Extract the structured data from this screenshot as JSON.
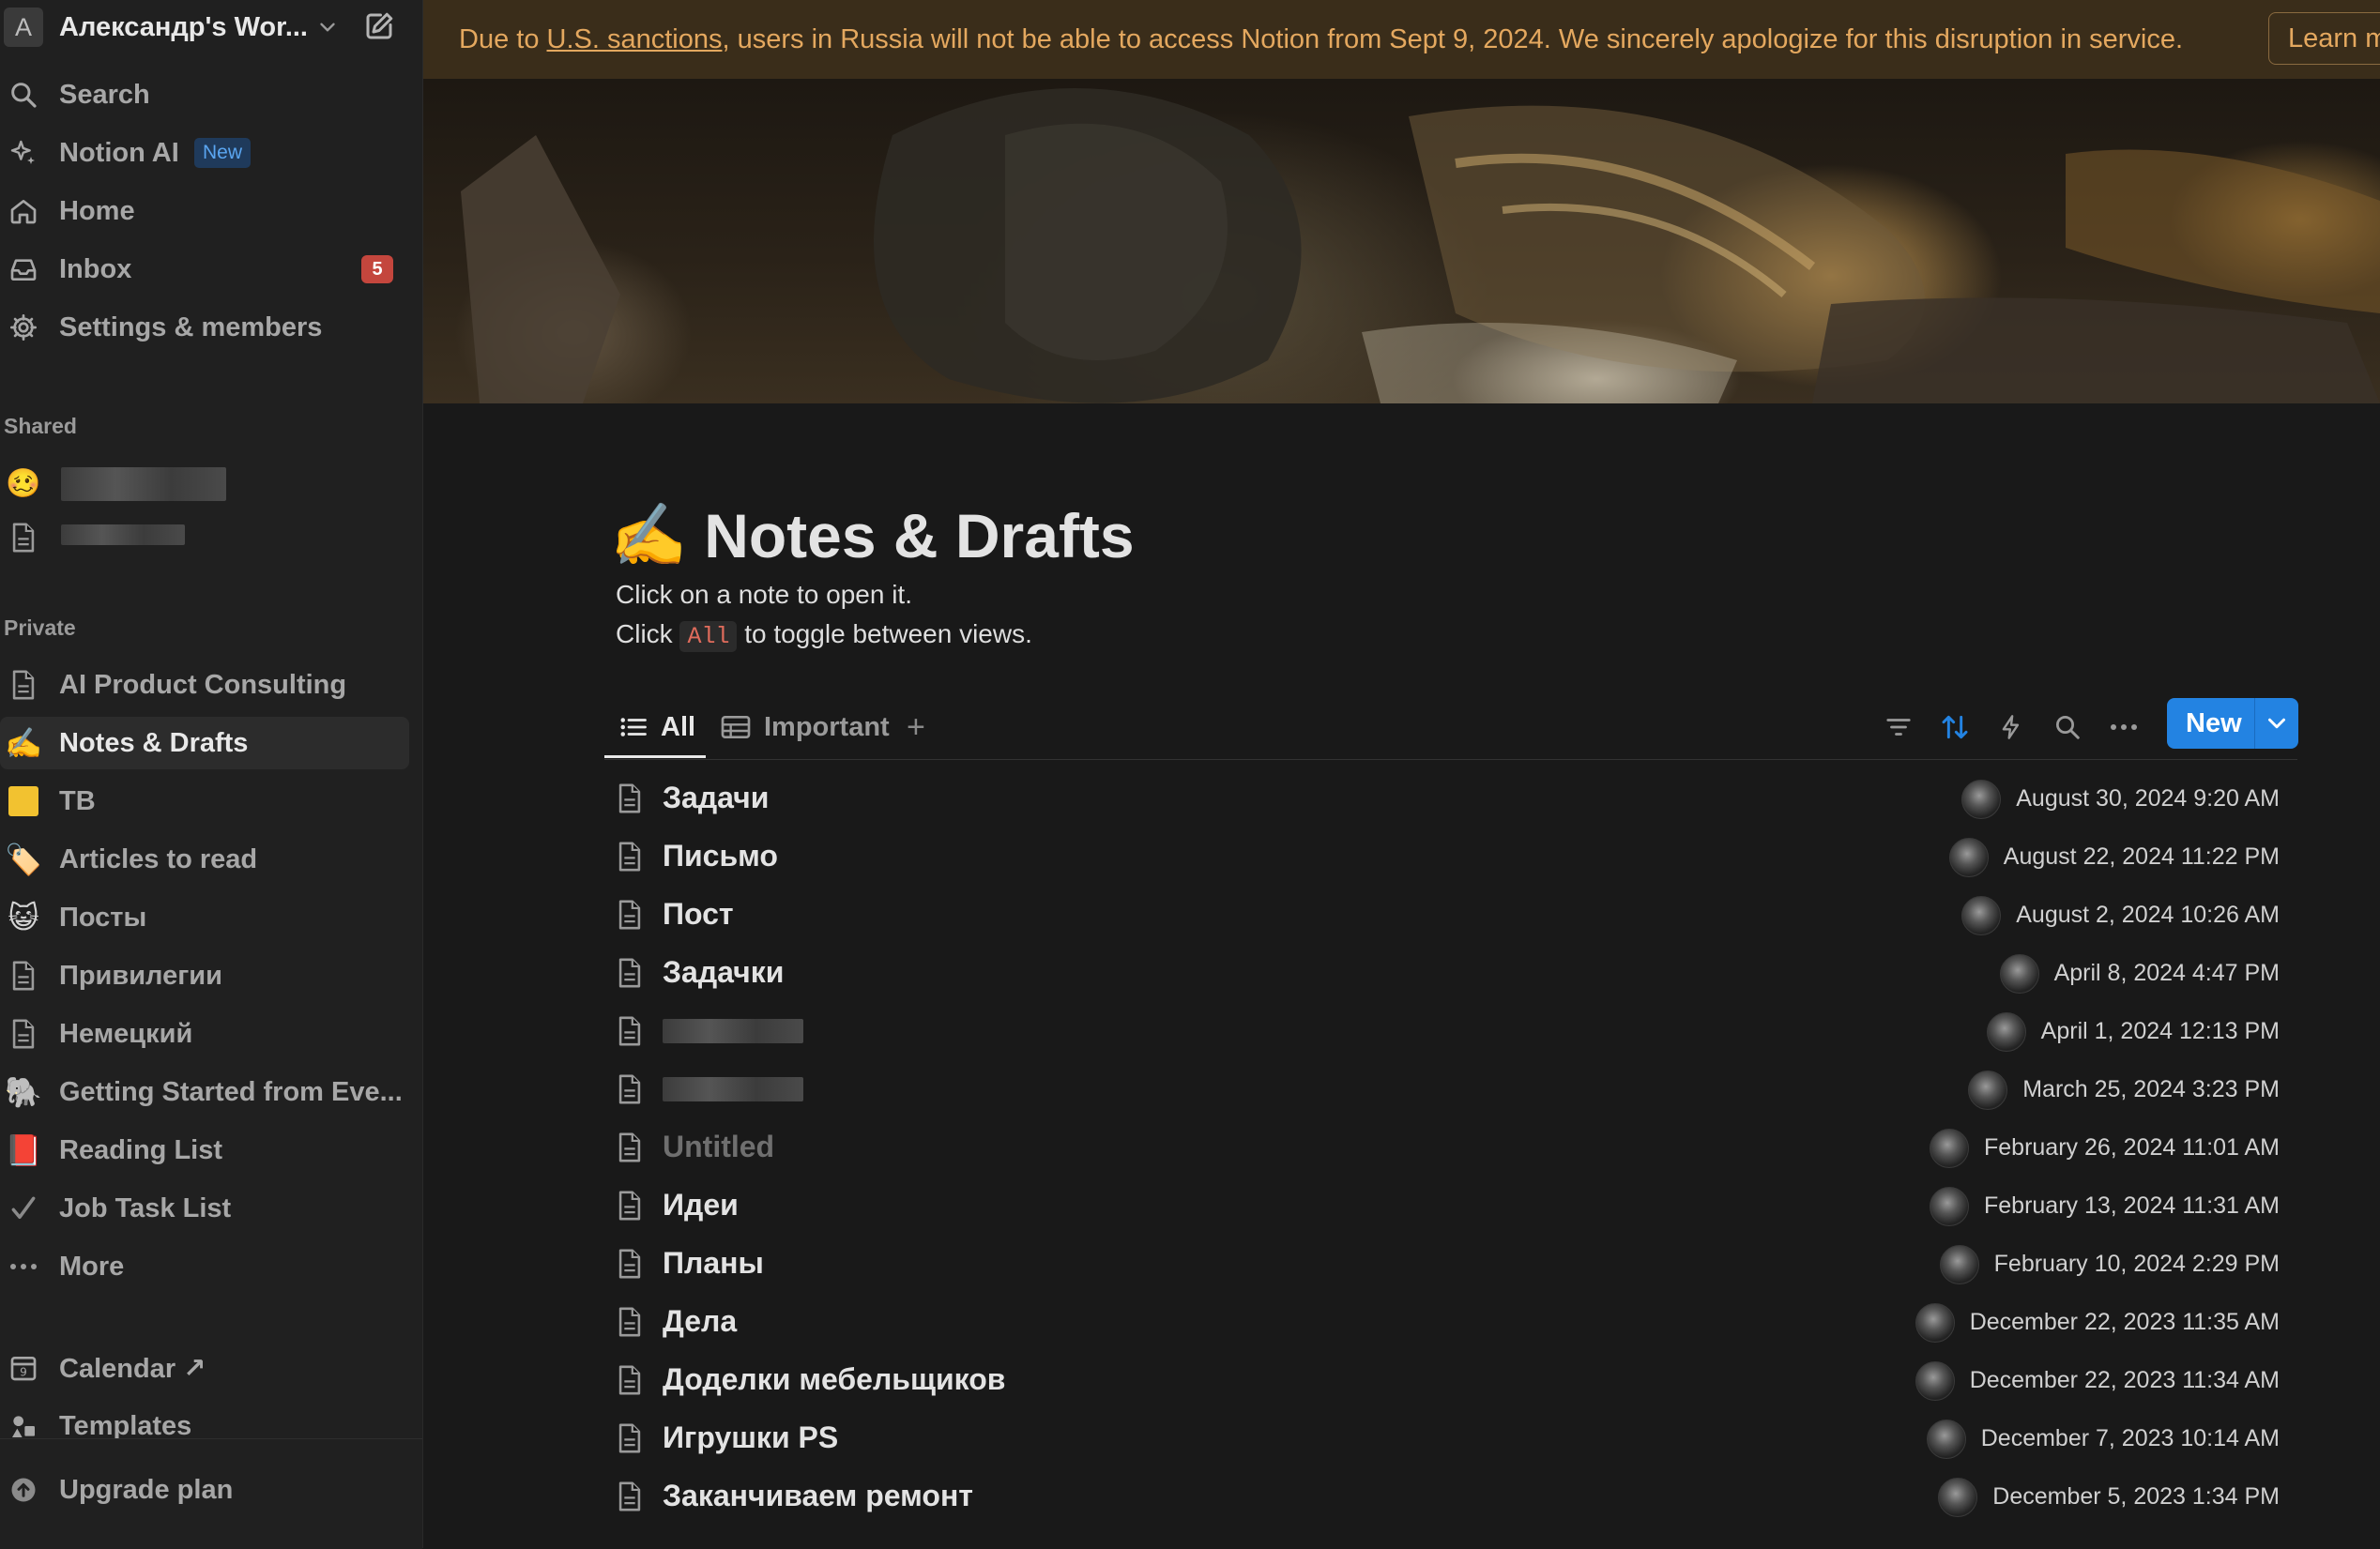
{
  "workspace": {
    "initial": "A",
    "name": "Александр's Wor..."
  },
  "sidebar": {
    "nav": [
      {
        "label": "Search"
      },
      {
        "label": "Notion AI",
        "badge": "New"
      },
      {
        "label": "Home"
      },
      {
        "label": "Inbox",
        "count": "5"
      },
      {
        "label": "Settings & members"
      }
    ],
    "shared_label": "Shared",
    "private_label": "Private",
    "private_items": [
      {
        "label": "AI Product Consulting",
        "icon": "page-icon"
      },
      {
        "label": "Notes & Drafts",
        "icon": "✍️"
      },
      {
        "label": "TB",
        "icon": "🟨"
      },
      {
        "label": "Articles to read",
        "icon": "🏷️"
      },
      {
        "label": "Посты",
        "icon": "😺"
      },
      {
        "label": "Привилегии",
        "icon": "page-icon"
      },
      {
        "label": "Немецкий",
        "icon": "page-icon"
      },
      {
        "label": "Getting Started from Eve...",
        "icon": "🐘"
      },
      {
        "label": "Reading List",
        "icon": "📕"
      },
      {
        "label": "Job Task List",
        "icon": "✔️"
      },
      {
        "label": "More",
        "icon": "•••"
      }
    ],
    "calendar_label": "Calendar ↗",
    "templates_label": "Templates",
    "upgrade_label": "Upgrade plan"
  },
  "banner": {
    "prefix": "Due to ",
    "link": "U.S. sanctions",
    "suffix": ", users in Russia will not be able to access Notion from Sept 9, 2024. We sincerely apologize for this disruption in service.",
    "button": "Learn m"
  },
  "page": {
    "emoji": "✍️",
    "title": "Notes & Drafts",
    "desc1": "Click on a note to open it.",
    "desc2_pre": "Click ",
    "desc2_code": "All",
    "desc2_post": " to toggle between views."
  },
  "views": {
    "tab_all": "All",
    "tab_important": "Important",
    "add": "+",
    "new_button": "New"
  },
  "colors": {
    "accent": "#2383e2",
    "banner_bg": "#3a2d1a",
    "banner_text": "#e4a85f",
    "badge": "#c4463d"
  },
  "notes": [
    {
      "title": "Задачи",
      "date": "August 30, 2024 9:20 AM"
    },
    {
      "title": "Письмо",
      "date": "August 22, 2024 11:22 PM"
    },
    {
      "title": "Пост",
      "date": "August 2, 2024 10:26 AM"
    },
    {
      "title": "Задачки",
      "date": "April 8, 2024 4:47 PM"
    },
    {
      "title": "",
      "redacted": true,
      "date": "April 1, 2024 12:13 PM"
    },
    {
      "title": "",
      "redacted": true,
      "date": "March 25, 2024 3:23 PM"
    },
    {
      "title": "Untitled",
      "muted": true,
      "date": "February 26, 2024 11:01 AM"
    },
    {
      "title": "Идеи",
      "date": "February 13, 2024 11:31 AM"
    },
    {
      "title": "Планы",
      "date": "February 10, 2024 2:29 PM"
    },
    {
      "title": "Дела",
      "date": "December 22, 2023 11:35 AM"
    },
    {
      "title": "Доделки мебельщиков",
      "date": "December 22, 2023 11:34 AM"
    },
    {
      "title": "Игрушки PS",
      "date": "December 7, 2023 10:14 AM"
    },
    {
      "title": "Заканчиваем ремонт",
      "date": "December 5, 2023 1:34 PM"
    }
  ]
}
